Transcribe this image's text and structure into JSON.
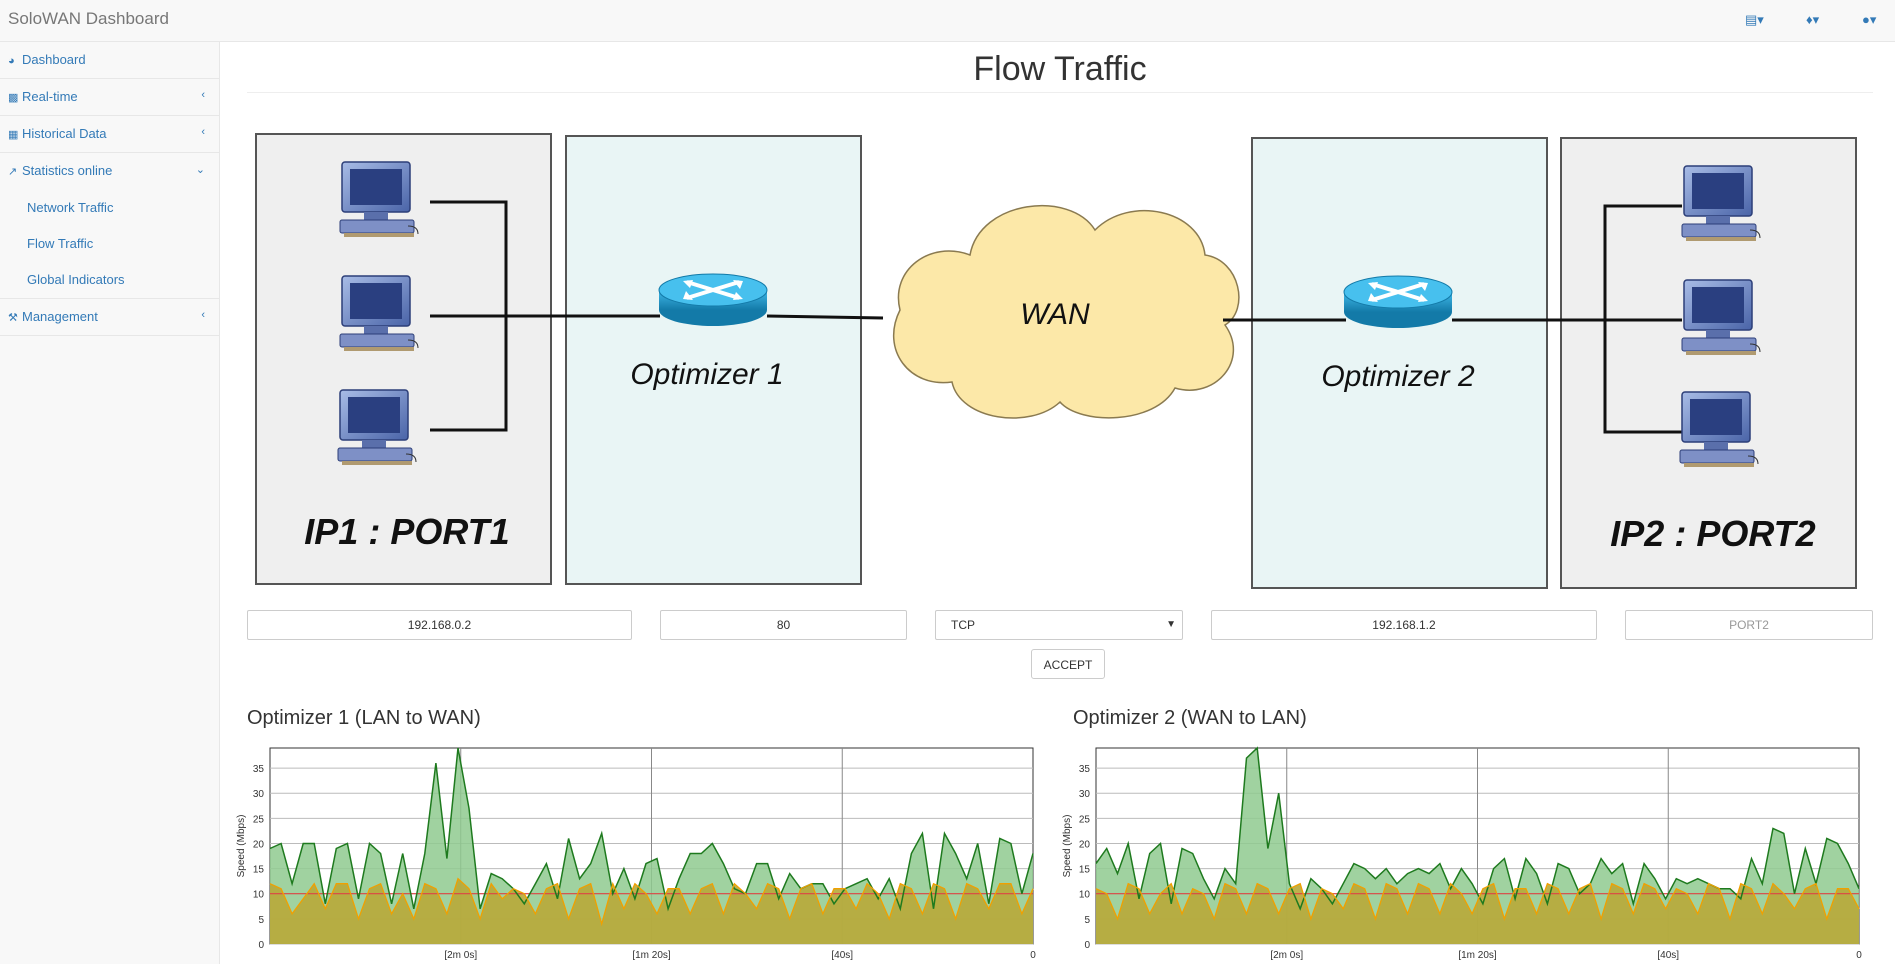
{
  "app": {
    "title": "SoloWAN Dashboard"
  },
  "topnav": {
    "icons": [
      "table-icon",
      "bell-icon",
      "user-icon"
    ]
  },
  "sidebar": {
    "items": [
      {
        "label": "Dashboard",
        "icon": "dashboard-icon"
      },
      {
        "label": "Real-time",
        "icon": "bar-chart-icon",
        "chevron": "left"
      },
      {
        "label": "Historical Data",
        "icon": "table-icon",
        "chevron": "left"
      },
      {
        "label": "Statistics online",
        "icon": "line-chart-icon",
        "chevron": "down"
      },
      {
        "label": "Management",
        "icon": "wrench-icon",
        "chevron": "left"
      }
    ],
    "subitems": [
      "Network Traffic",
      "Flow Traffic",
      "Global Indicators"
    ]
  },
  "page": {
    "title": "Flow Traffic"
  },
  "diagram": {
    "left_host_label": "IP1 : PORT1",
    "optimizer1_label": "Optimizer 1",
    "wan_label": "WAN",
    "optimizer2_label": "Optimizer 2",
    "right_host_label": "IP2 : PORT2"
  },
  "form": {
    "ip1": "192.168.0.2",
    "port1": "80",
    "protocol": "TCP",
    "ip2": "192.168.1.2",
    "port2_placeholder": "PORT2",
    "accept_label": "ACCEPT"
  },
  "colors": {
    "green_line": "#1e7a1e",
    "green_fill": "#8fca8f",
    "orange_line": "#f0a000",
    "orange_fill": "#b8a838",
    "red_line": "#d44"
  },
  "chart_data": [
    {
      "type": "area",
      "title": "Optimizer 1 (LAN to WAN)",
      "ylabel": "Speed (Mbps)",
      "ylim": [
        0,
        39
      ],
      "yticks": [
        0,
        5,
        10,
        15,
        20,
        25,
        30,
        35
      ],
      "xticks": [
        "[2m 0s]",
        "[1m 20s]",
        "[40s]",
        "0"
      ],
      "series": [
        {
          "values": [
            19,
            20,
            12,
            20,
            20,
            8,
            19,
            20,
            9,
            20,
            18,
            8,
            18,
            7,
            18,
            36,
            17,
            39,
            27,
            7,
            14,
            13,
            11,
            8,
            12,
            16,
            9,
            21,
            13,
            16,
            22,
            10,
            15,
            9,
            16,
            17,
            7,
            13,
            18,
            18,
            20,
            16,
            11,
            10,
            16,
            16,
            9,
            14,
            11,
            12,
            12,
            8,
            11,
            12,
            13,
            9,
            13,
            7,
            18,
            22,
            7,
            22,
            18,
            13,
            20,
            8,
            21,
            20,
            10,
            18
          ]
        },
        {
          "values": [
            12,
            11,
            6,
            9,
            12,
            7,
            12,
            12,
            5,
            11,
            12,
            6,
            10,
            5,
            12,
            11,
            6,
            13,
            11,
            5,
            12,
            9,
            11,
            10,
            6,
            11,
            12,
            5,
            11,
            12,
            4,
            12,
            7,
            12,
            10,
            6,
            11,
            11,
            6,
            11,
            12,
            6,
            12,
            10,
            7,
            12,
            11,
            5,
            11,
            12,
            6,
            11,
            11,
            7,
            12,
            10,
            5,
            12,
            11,
            6,
            12,
            11,
            5,
            12,
            11,
            7,
            12,
            12,
            6,
            11
          ]
        },
        {
          "values": [
            10,
            10,
            10,
            10,
            10,
            10,
            10,
            10,
            10,
            10,
            10,
            10,
            10,
            10,
            10,
            10,
            10,
            10,
            10,
            10,
            10,
            10,
            10,
            10,
            10,
            10,
            10,
            10,
            10,
            10,
            10,
            10,
            10,
            10,
            10,
            10,
            10,
            10,
            10,
            10,
            10,
            10,
            10,
            10,
            10,
            10,
            10,
            10,
            10,
            10,
            10,
            10,
            10,
            10,
            10,
            10,
            10,
            10,
            10,
            10,
            10,
            10,
            10,
            10,
            10,
            10,
            10,
            10,
            10,
            10
          ]
        }
      ]
    },
    {
      "type": "area",
      "title": "Optimizer 2 (WAN to LAN)",
      "ylabel": "Speed (Mbps)",
      "ylim": [
        0,
        39
      ],
      "yticks": [
        0,
        5,
        10,
        15,
        20,
        25,
        30,
        35
      ],
      "xticks": [
        "[2m 0s]",
        "[1m 20s]",
        "[40s]",
        "0"
      ],
      "series": [
        {
          "values": [
            16,
            19,
            14,
            20,
            9,
            18,
            20,
            8,
            19,
            18,
            13,
            9,
            15,
            12,
            37,
            39,
            19,
            30,
            12,
            7,
            13,
            11,
            8,
            12,
            16,
            15,
            13,
            15,
            12,
            14,
            15,
            14,
            16,
            11,
            15,
            12,
            8,
            15,
            17,
            9,
            17,
            14,
            8,
            16,
            15,
            10,
            12,
            17,
            14,
            16,
            8,
            16,
            13,
            9,
            13,
            12,
            13,
            12,
            11,
            11,
            9,
            17,
            12,
            23,
            22,
            10,
            19,
            12,
            21,
            20,
            16,
            11
          ]
        },
        {
          "values": [
            11,
            10,
            5,
            12,
            11,
            6,
            10,
            12,
            6,
            11,
            10,
            5,
            12,
            11,
            6,
            12,
            11,
            6,
            11,
            12,
            5,
            11,
            10,
            7,
            12,
            11,
            5,
            12,
            11,
            6,
            12,
            11,
            6,
            12,
            10,
            6,
            11,
            12,
            5,
            11,
            11,
            6,
            12,
            11,
            6,
            11,
            12,
            5,
            12,
            11,
            6,
            12,
            11,
            7,
            11,
            10,
            6,
            12,
            11,
            5,
            12,
            11,
            6,
            12,
            10,
            7,
            11,
            12,
            5,
            11,
            11,
            7
          ]
        },
        {
          "values": [
            10,
            10,
            10,
            10,
            10,
            10,
            10,
            10,
            10,
            10,
            10,
            10,
            10,
            10,
            10,
            10,
            10,
            10,
            10,
            10,
            10,
            10,
            10,
            10,
            10,
            10,
            10,
            10,
            10,
            10,
            10,
            10,
            10,
            10,
            10,
            10,
            10,
            10,
            10,
            10,
            10,
            10,
            10,
            10,
            10,
            10,
            10,
            10,
            10,
            10,
            10,
            10,
            10,
            10,
            10,
            10,
            10,
            10,
            10,
            10,
            10,
            10,
            10,
            10,
            10,
            10,
            10,
            10,
            10,
            10,
            10,
            10
          ]
        }
      ]
    }
  ]
}
